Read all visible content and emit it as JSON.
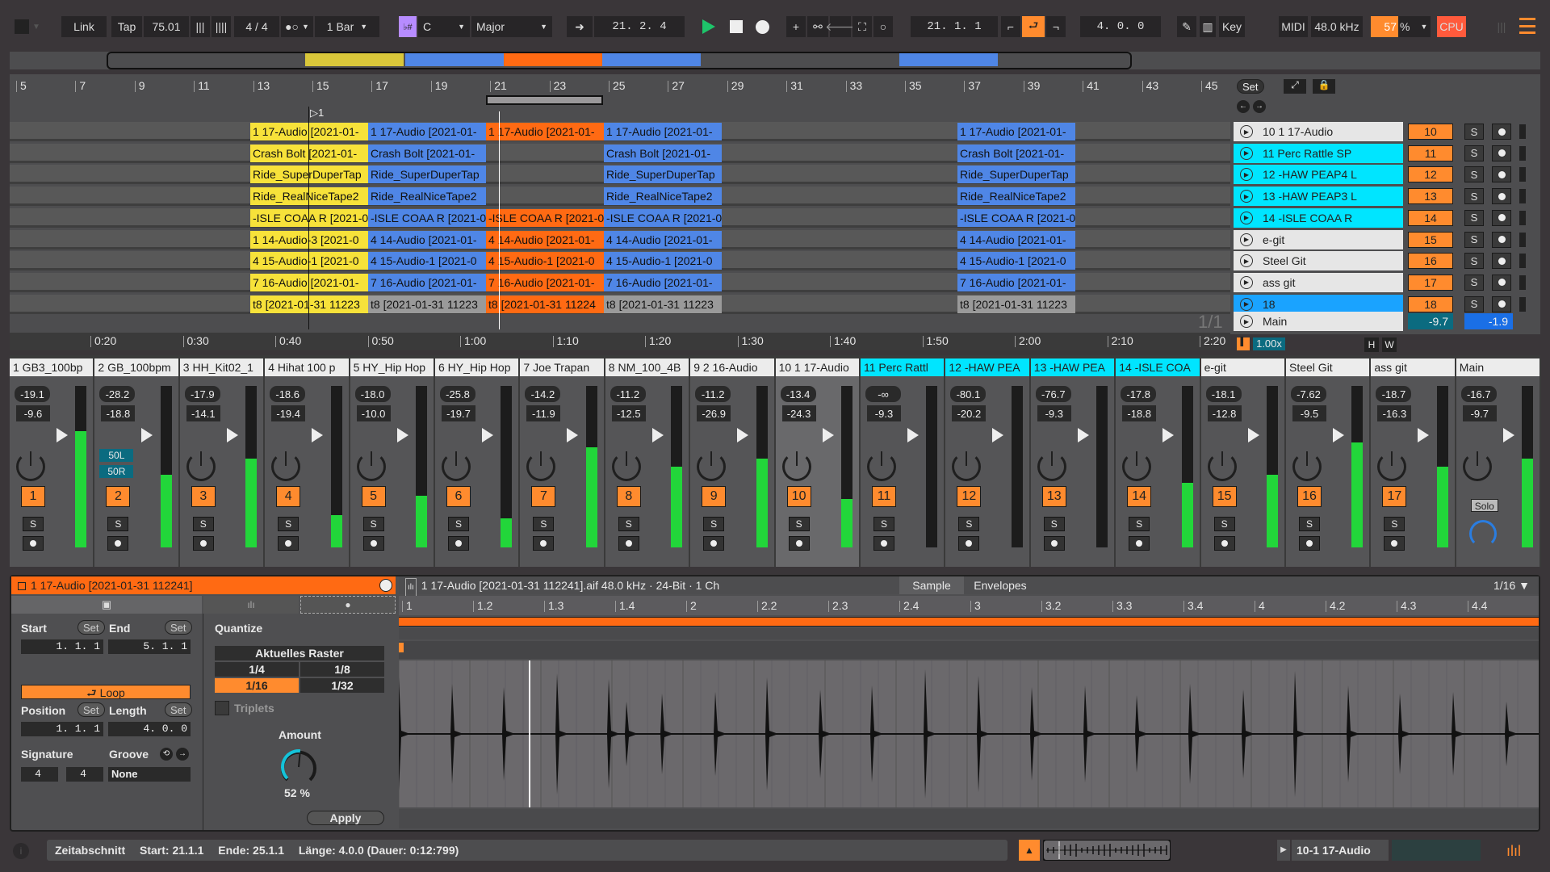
{
  "transport": {
    "link": "Link",
    "tap": "Tap",
    "tempo": "75.01",
    "signature": "4 / 4",
    "metronome": "●○",
    "quantization": "1 Bar",
    "scale_key": "C",
    "scale_mode": "Major",
    "arrangement_position": "21.  2.  4",
    "loop_start": "21.  1.  1",
    "loop_length": "4.  0.  0",
    "key_label": "Key",
    "midi_label": "MIDI",
    "sample_rate": "48.0 kHz",
    "cpu_percent": "57",
    "cpu_unit": "%",
    "cpu_label": "CPU",
    "colors": {
      "play": "#1ec46a",
      "loop": "#ff8b2e",
      "scale": "#b78cff",
      "cpu": "#ff5a3c"
    }
  },
  "arrangement": {
    "ruler": [
      "5",
      "7",
      "9",
      "11",
      "13",
      "15",
      "17",
      "19",
      "21",
      "23",
      "25",
      "27",
      "29",
      "31",
      "33",
      "35",
      "37",
      "39",
      "41",
      "43",
      "45"
    ],
    "locator_label": "1",
    "time_ruler": [
      "0:20",
      "0:30",
      "0:40",
      "0:50",
      "1:00",
      "1:10",
      "1:20",
      "1:30",
      "1:40",
      "1:50",
      "2:00",
      "2:10",
      "2:20"
    ],
    "page_indicator": "1/1",
    "set_label": "Set",
    "zoom_label": "1.00x",
    "h_label": "H",
    "w_label": "W",
    "lanes": [
      {
        "clips": [
          {
            "color": "#f7e23a",
            "label": "1 17-Audio [2021-01-"
          },
          {
            "color": "#4f86e6",
            "label": "1 17-Audio [2021-01-"
          },
          {
            "color": "#ff6a13",
            "label": "1 17-Audio [2021-01-"
          },
          {
            "color": "#4f86e6",
            "label": "1 17-Audio [2021-01-"
          },
          {
            "color": "#4f86e6",
            "label": "1 17-Audio [2021-01-"
          }
        ]
      },
      {
        "clips": [
          {
            "color": "#f7e23a",
            "label": "Crash Bolt [2021-01-"
          },
          {
            "color": "#4f86e6",
            "label": "Crash Bolt [2021-01-"
          },
          null,
          {
            "color": "#4f86e6",
            "label": "Crash Bolt [2021-01-"
          },
          {
            "color": "#4f86e6",
            "label": "Crash Bolt [2021-01-"
          }
        ]
      },
      {
        "clips": [
          {
            "color": "#f7e23a",
            "label": "Ride_SuperDuperTap"
          },
          {
            "color": "#4f86e6",
            "label": "Ride_SuperDuperTap"
          },
          null,
          {
            "color": "#4f86e6",
            "label": "Ride_SuperDuperTap"
          },
          {
            "color": "#4f86e6",
            "label": "Ride_SuperDuperTap"
          }
        ]
      },
      {
        "clips": [
          {
            "color": "#f7e23a",
            "label": "Ride_RealNiceTape2"
          },
          {
            "color": "#4f86e6",
            "label": "Ride_RealNiceTape2"
          },
          null,
          {
            "color": "#4f86e6",
            "label": "Ride_RealNiceTape2"
          },
          {
            "color": "#4f86e6",
            "label": "Ride_RealNiceTape2"
          }
        ]
      },
      {
        "clips": [
          {
            "color": "#f7e23a",
            "label": "-ISLE COAA R [2021-0"
          },
          {
            "color": "#4f86e6",
            "label": "-ISLE COAA R [2021-0"
          },
          {
            "color": "#ff6a13",
            "label": "-ISLE COAA R [2021-0"
          },
          {
            "color": "#4f86e6",
            "label": "-ISLE COAA R [2021-0"
          },
          {
            "color": "#4f86e6",
            "label": "-ISLE COAA R [2021-0"
          }
        ]
      },
      {
        "clips": [
          {
            "color": "#f7e23a",
            "label": "1 14-Audio-3 [2021-0"
          },
          {
            "color": "#4f86e6",
            "label": "4 14-Audio [2021-01-"
          },
          {
            "color": "#ff6a13",
            "label": "4 14-Audio [2021-01-"
          },
          {
            "color": "#4f86e6",
            "label": "4 14-Audio [2021-01-"
          },
          {
            "color": "#4f86e6",
            "label": "4 14-Audio [2021-01-"
          }
        ]
      },
      {
        "clips": [
          {
            "color": "#f7e23a",
            "label": "4 15-Audio-1 [2021-0"
          },
          {
            "color": "#4f86e6",
            "label": "4 15-Audio-1 [2021-0"
          },
          {
            "color": "#ff6a13",
            "label": "4 15-Audio-1 [2021-0"
          },
          {
            "color": "#4f86e6",
            "label": "4 15-Audio-1 [2021-0"
          },
          {
            "color": "#4f86e6",
            "label": "4 15-Audio-1 [2021-0"
          }
        ]
      },
      {
        "clips": [
          {
            "color": "#f7e23a",
            "label": "7 16-Audio [2021-01-"
          },
          {
            "color": "#4f86e6",
            "label": "7 16-Audio [2021-01-"
          },
          {
            "color": "#ff6a13",
            "label": "7 16-Audio [2021-01-"
          },
          {
            "color": "#4f86e6",
            "label": "7 16-Audio [2021-01-"
          },
          {
            "color": "#4f86e6",
            "label": "7 16-Audio [2021-01-"
          }
        ]
      },
      {
        "clips": [
          {
            "color": "#f7e23a",
            "label": "t8 [2021-01-31 11223"
          },
          {
            "color": "#9a9a9a",
            "label": "t8 [2021-01-31 11223"
          },
          {
            "color": "#ff6a13",
            "label": "t8 [2021-01-31 11224"
          },
          {
            "color": "#9a9a9a",
            "label": "t8 [2021-01-31 11223"
          },
          {
            "color": "#9a9a9a",
            "label": "t8 [2021-01-31 11223"
          }
        ]
      }
    ],
    "tracks": [
      {
        "name": "10 1 17-Audio",
        "num": "10",
        "color": "#e6e6e6"
      },
      {
        "name": "11 Perc Rattle SP",
        "num": "11",
        "color": "#00e5ff"
      },
      {
        "name": "12 -HAW PEAP4 L",
        "num": "12",
        "color": "#00e5ff"
      },
      {
        "name": "13 -HAW PEAP3 L",
        "num": "13",
        "color": "#00e5ff"
      },
      {
        "name": "14 -ISLE COAA R",
        "num": "14",
        "color": "#00e5ff"
      },
      {
        "name": "e-git",
        "num": "15",
        "color": "#e6e6e6"
      },
      {
        "name": "Steel Git",
        "num": "16",
        "color": "#e6e6e6"
      },
      {
        "name": "ass git",
        "num": "17",
        "color": "#e6e6e6"
      },
      {
        "name": "18",
        "num": "18",
        "color": "#1aa3ff"
      }
    ],
    "solo_label": "S",
    "main_track": {
      "name": "Main",
      "vol": "-9.7",
      "pan": "-1.9"
    }
  },
  "mixer": {
    "strips": [
      {
        "name": "1 GB3_100bp",
        "peak": "-19.1",
        "vol": "-9.6",
        "num": "1",
        "level": 0.72,
        "cyan": false
      },
      {
        "name": "2 GB_100bpm",
        "peak": "-28.2",
        "vol": "-18.8",
        "num": "2",
        "level": 0.45,
        "cyan": false,
        "pan_l": "50L",
        "pan_r": "50R"
      },
      {
        "name": "3 HH_Kit02_1",
        "peak": "-17.9",
        "vol": "-14.1",
        "num": "3",
        "level": 0.55,
        "cyan": false
      },
      {
        "name": "4 Hihat 100 p",
        "peak": "-18.6",
        "vol": "-19.4",
        "num": "4",
        "level": 0.2,
        "cyan": false
      },
      {
        "name": "5 HY_Hip Hop",
        "peak": "-18.0",
        "vol": "-10.0",
        "num": "5",
        "level": 0.32,
        "cyan": false
      },
      {
        "name": "6 HY_Hip Hop",
        "peak": "-25.8",
        "vol": "-19.7",
        "num": "6",
        "level": 0.18,
        "cyan": false
      },
      {
        "name": "7 Joe Trapan",
        "peak": "-14.2",
        "vol": "-11.9",
        "num": "7",
        "level": 0.62,
        "cyan": false
      },
      {
        "name": "8 NM_100_4B",
        "peak": "-11.2",
        "vol": "-12.5",
        "num": "8",
        "level": 0.5,
        "cyan": false
      },
      {
        "name": "9 2 16-Audio",
        "peak": "-11.2",
        "vol": "-26.9",
        "num": "9",
        "level": 0.55,
        "cyan": false
      },
      {
        "name": "10 1 17-Audio",
        "peak": "-13.4",
        "vol": "-24.3",
        "num": "10",
        "level": 0.3,
        "cyan": false
      },
      {
        "name": "11 Perc Rattl",
        "peak": "-∞",
        "vol": "-9.3",
        "num": "11",
        "level": 0,
        "cyan": true
      },
      {
        "name": "12 -HAW PEA",
        "peak": "-80.1",
        "vol": "-20.2",
        "num": "12",
        "level": 0,
        "cyan": true
      },
      {
        "name": "13 -HAW PEA",
        "peak": "-76.7",
        "vol": "-9.3",
        "num": "13",
        "level": 0,
        "cyan": true
      },
      {
        "name": "14 -ISLE COA",
        "peak": "-17.8",
        "vol": "-18.8",
        "num": "14",
        "level": 0.4,
        "cyan": true
      },
      {
        "name": "e-git",
        "peak": "-18.1",
        "vol": "-12.8",
        "num": "15",
        "level": 0.45,
        "cyan": false
      },
      {
        "name": "Steel Git",
        "peak": "-7.62",
        "vol": "-9.5",
        "num": "16",
        "level": 0.65,
        "cyan": false
      },
      {
        "name": "ass git",
        "peak": "-18.7",
        "vol": "-16.3",
        "num": "17",
        "level": 0.5,
        "cyan": false
      },
      {
        "name": "Main",
        "peak": "-16.7",
        "vol": "-9.7",
        "num": "",
        "level": 0.55,
        "cyan": false,
        "solo_label": "Solo"
      }
    ]
  },
  "clip": {
    "title": "1 17-Audio [2021-01-31 112241]",
    "start_label": "Start",
    "end_label": "End",
    "set_label": "Set",
    "start": "1.  1.  1",
    "end": "5.  1.  1",
    "loop_label": "Loop",
    "position_label": "Position",
    "length_label": "Length",
    "position": "1.  1.  1",
    "length": "4.  0.  0",
    "signature_label": "Signature",
    "sig_num": "4",
    "sig_den": "4",
    "groove_label": "Groove",
    "groove": "None",
    "quantize_label": "Quantize",
    "quantize_current": "Aktuelles Raster",
    "quantize_opts": [
      "1/4",
      "1/8",
      "1/16",
      "1/32"
    ],
    "quantize_selected": "1/16",
    "triplets": "Triplets",
    "amount_label": "Amount",
    "amount": "52 %",
    "amount_value": 0.52,
    "apply": "Apply",
    "file_info": "1 17-Audio [2021-01-31 112241].aif  48.0 kHz · 24-Bit · 1 Ch",
    "tab_sample": "Sample",
    "tab_envelopes": "Envelopes",
    "grid": "1/16 ▼",
    "ruler": [
      "1",
      "1.2",
      "1.3",
      "1.4",
      "2",
      "2.2",
      "2.3",
      "2.4",
      "3",
      "3.2",
      "3.3",
      "3.4",
      "4",
      "4.2",
      "4.3",
      "4.4"
    ]
  },
  "status": {
    "label": "Zeitabschnitt",
    "start": "Start: 21.1.1",
    "end": "Ende: 25.1.1",
    "length": "Länge: 4.0.0 (Dauer: 0:12:799)",
    "device_track": "10-1 17-Audio"
  }
}
